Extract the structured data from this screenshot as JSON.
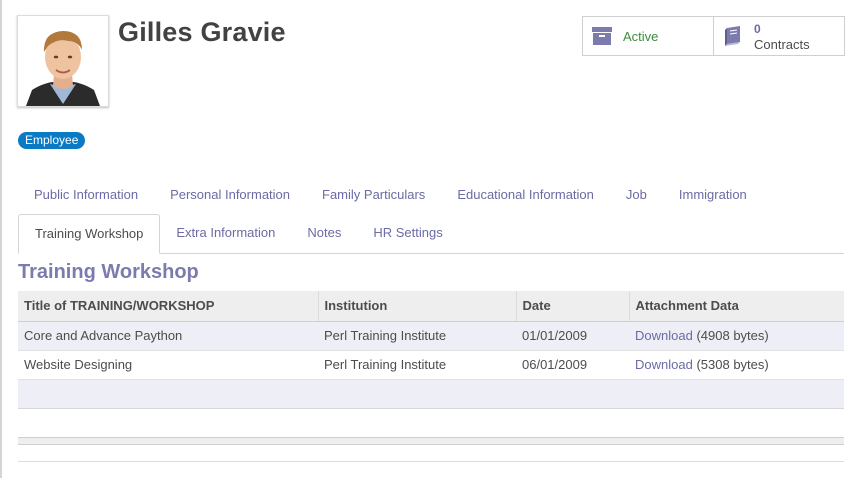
{
  "employee": {
    "name": "Gilles Gravie",
    "tag": "Employee"
  },
  "smart_buttons": {
    "active_label": "Active",
    "contracts_count": "0",
    "contracts_label": "Contracts"
  },
  "tabs_row1": [
    "Public Information",
    "Personal Information",
    "Family Particulars",
    "Educational Information",
    "Job",
    "Immigration"
  ],
  "tabs_row2": [
    "Training Workshop",
    "Extra Information",
    "Notes",
    "HR Settings"
  ],
  "active_tab": "Training Workshop",
  "section": {
    "title": "Training Workshop"
  },
  "table": {
    "headers": [
      "Title of TRAINING/WORKSHOP",
      "Institution",
      "Date",
      "Attachment Data"
    ],
    "rows": [
      {
        "title": "Core and Advance Paython",
        "institution": "Perl Training Institute",
        "date": "01/01/2009",
        "link": "Download",
        "size": "(4908 bytes)"
      },
      {
        "title": "Website Designing",
        "institution": "Perl Training Institute",
        "date": "06/01/2009",
        "link": "Download",
        "size": "(5308 bytes)"
      }
    ]
  },
  "icons": {
    "active": "archive-box-icon",
    "contracts": "book-icon"
  },
  "colors": {
    "accent": "#7c7bad",
    "link": "#6b6ba5",
    "tag": "#0a7ac4",
    "active_green": "#3d8c3d"
  }
}
